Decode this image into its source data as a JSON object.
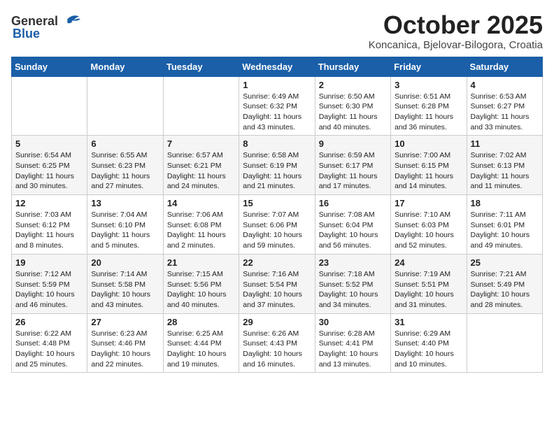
{
  "header": {
    "logo_general": "General",
    "logo_blue": "Blue",
    "month": "October 2025",
    "location": "Koncanica, Bjelovar-Bilogora, Croatia"
  },
  "columns": [
    "Sunday",
    "Monday",
    "Tuesday",
    "Wednesday",
    "Thursday",
    "Friday",
    "Saturday"
  ],
  "weeks": [
    [
      {
        "day": "",
        "text": ""
      },
      {
        "day": "",
        "text": ""
      },
      {
        "day": "",
        "text": ""
      },
      {
        "day": "1",
        "text": "Sunrise: 6:49 AM\nSunset: 6:32 PM\nDaylight: 11 hours\nand 43 minutes."
      },
      {
        "day": "2",
        "text": "Sunrise: 6:50 AM\nSunset: 6:30 PM\nDaylight: 11 hours\nand 40 minutes."
      },
      {
        "day": "3",
        "text": "Sunrise: 6:51 AM\nSunset: 6:28 PM\nDaylight: 11 hours\nand 36 minutes."
      },
      {
        "day": "4",
        "text": "Sunrise: 6:53 AM\nSunset: 6:27 PM\nDaylight: 11 hours\nand 33 minutes."
      }
    ],
    [
      {
        "day": "5",
        "text": "Sunrise: 6:54 AM\nSunset: 6:25 PM\nDaylight: 11 hours\nand 30 minutes."
      },
      {
        "day": "6",
        "text": "Sunrise: 6:55 AM\nSunset: 6:23 PM\nDaylight: 11 hours\nand 27 minutes."
      },
      {
        "day": "7",
        "text": "Sunrise: 6:57 AM\nSunset: 6:21 PM\nDaylight: 11 hours\nand 24 minutes."
      },
      {
        "day": "8",
        "text": "Sunrise: 6:58 AM\nSunset: 6:19 PM\nDaylight: 11 hours\nand 21 minutes."
      },
      {
        "day": "9",
        "text": "Sunrise: 6:59 AM\nSunset: 6:17 PM\nDaylight: 11 hours\nand 17 minutes."
      },
      {
        "day": "10",
        "text": "Sunrise: 7:00 AM\nSunset: 6:15 PM\nDaylight: 11 hours\nand 14 minutes."
      },
      {
        "day": "11",
        "text": "Sunrise: 7:02 AM\nSunset: 6:13 PM\nDaylight: 11 hours\nand 11 minutes."
      }
    ],
    [
      {
        "day": "12",
        "text": "Sunrise: 7:03 AM\nSunset: 6:12 PM\nDaylight: 11 hours\nand 8 minutes."
      },
      {
        "day": "13",
        "text": "Sunrise: 7:04 AM\nSunset: 6:10 PM\nDaylight: 11 hours\nand 5 minutes."
      },
      {
        "day": "14",
        "text": "Sunrise: 7:06 AM\nSunset: 6:08 PM\nDaylight: 11 hours\nand 2 minutes."
      },
      {
        "day": "15",
        "text": "Sunrise: 7:07 AM\nSunset: 6:06 PM\nDaylight: 10 hours\nand 59 minutes."
      },
      {
        "day": "16",
        "text": "Sunrise: 7:08 AM\nSunset: 6:04 PM\nDaylight: 10 hours\nand 56 minutes."
      },
      {
        "day": "17",
        "text": "Sunrise: 7:10 AM\nSunset: 6:03 PM\nDaylight: 10 hours\nand 52 minutes."
      },
      {
        "day": "18",
        "text": "Sunrise: 7:11 AM\nSunset: 6:01 PM\nDaylight: 10 hours\nand 49 minutes."
      }
    ],
    [
      {
        "day": "19",
        "text": "Sunrise: 7:12 AM\nSunset: 5:59 PM\nDaylight: 10 hours\nand 46 minutes."
      },
      {
        "day": "20",
        "text": "Sunrise: 7:14 AM\nSunset: 5:58 PM\nDaylight: 10 hours\nand 43 minutes."
      },
      {
        "day": "21",
        "text": "Sunrise: 7:15 AM\nSunset: 5:56 PM\nDaylight: 10 hours\nand 40 minutes."
      },
      {
        "day": "22",
        "text": "Sunrise: 7:16 AM\nSunset: 5:54 PM\nDaylight: 10 hours\nand 37 minutes."
      },
      {
        "day": "23",
        "text": "Sunrise: 7:18 AM\nSunset: 5:52 PM\nDaylight: 10 hours\nand 34 minutes."
      },
      {
        "day": "24",
        "text": "Sunrise: 7:19 AM\nSunset: 5:51 PM\nDaylight: 10 hours\nand 31 minutes."
      },
      {
        "day": "25",
        "text": "Sunrise: 7:21 AM\nSunset: 5:49 PM\nDaylight: 10 hours\nand 28 minutes."
      }
    ],
    [
      {
        "day": "26",
        "text": "Sunrise: 6:22 AM\nSunset: 4:48 PM\nDaylight: 10 hours\nand 25 minutes."
      },
      {
        "day": "27",
        "text": "Sunrise: 6:23 AM\nSunset: 4:46 PM\nDaylight: 10 hours\nand 22 minutes."
      },
      {
        "day": "28",
        "text": "Sunrise: 6:25 AM\nSunset: 4:44 PM\nDaylight: 10 hours\nand 19 minutes."
      },
      {
        "day": "29",
        "text": "Sunrise: 6:26 AM\nSunset: 4:43 PM\nDaylight: 10 hours\nand 16 minutes."
      },
      {
        "day": "30",
        "text": "Sunrise: 6:28 AM\nSunset: 4:41 PM\nDaylight: 10 hours\nand 13 minutes."
      },
      {
        "day": "31",
        "text": "Sunrise: 6:29 AM\nSunset: 4:40 PM\nDaylight: 10 hours\nand 10 minutes."
      },
      {
        "day": "",
        "text": ""
      }
    ]
  ]
}
